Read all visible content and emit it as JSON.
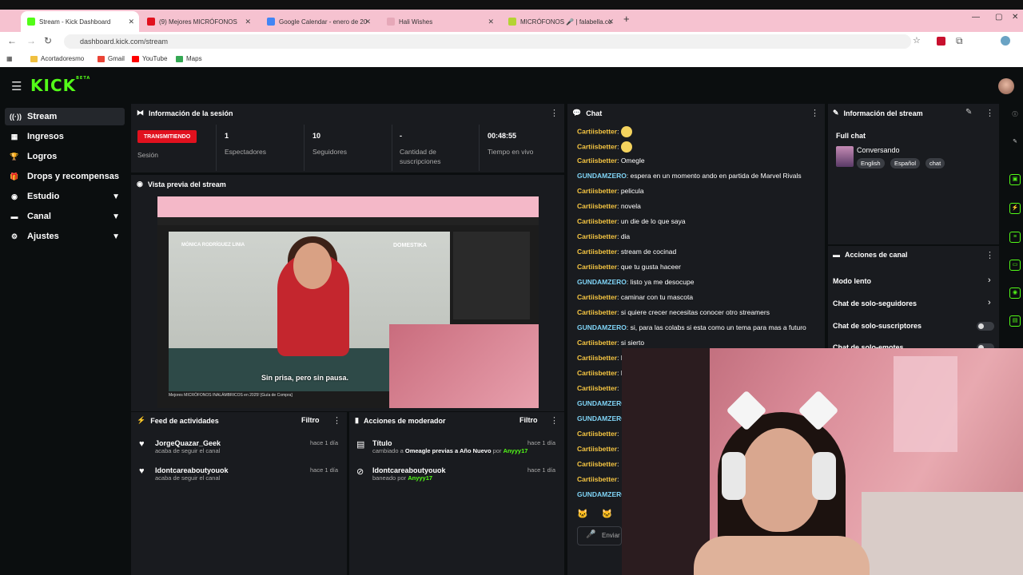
{
  "browser": {
    "tabs": [
      {
        "label": "Stream - Kick Dashboard",
        "favicon_color": "#53fc18",
        "active": true
      },
      {
        "label": "(9) Mejores MICRÓFONOS",
        "favicon_color": "#e1111e",
        "active": false
      },
      {
        "label": "Google Calendar - enero de 20",
        "favicon_color": "#4285f4",
        "active": false
      },
      {
        "label": "Hali Wishes",
        "favicon_color": "#e6a8b8",
        "active": false
      },
      {
        "label": "MICRÓFONOS 🎤 | falabella.co",
        "favicon_color": "#b5d334",
        "active": false
      }
    ],
    "new_tab": "+",
    "url": "dashboard.kick.com/stream",
    "bookmarks": [
      {
        "label": "Acortadoresmo",
        "icon_color": "#f0c040"
      },
      {
        "label": "Gmail",
        "icon_color": "#ea4335"
      },
      {
        "label": "YouTube",
        "icon_color": "#ff0000"
      },
      {
        "label": "Maps",
        "icon_color": "#34a853"
      }
    ]
  },
  "header": {
    "logo": "KICK",
    "logo_sup": "BETA"
  },
  "sidebar": {
    "items": [
      {
        "label": "Stream",
        "icon": "stream-icon",
        "glyph": "((·))",
        "active": true,
        "expandable": false
      },
      {
        "label": "Ingresos",
        "icon": "revenue-icon",
        "glyph": "▦",
        "active": false,
        "expandable": false
      },
      {
        "label": "Logros",
        "icon": "trophy-icon",
        "glyph": "🏆",
        "active": false,
        "expandable": false
      },
      {
        "label": "Drops y recompensas",
        "icon": "gift-icon",
        "glyph": "🎁",
        "active": false,
        "expandable": false
      },
      {
        "label": "Estudio",
        "icon": "studio-icon",
        "glyph": "◉",
        "active": false,
        "expandable": true
      },
      {
        "label": "Canal",
        "icon": "channel-icon",
        "glyph": "▬",
        "active": false,
        "expandable": true
      },
      {
        "label": "Ajustes",
        "icon": "gear-icon",
        "glyph": "⚙",
        "active": false,
        "expandable": true
      }
    ]
  },
  "session": {
    "title": "Información de la sesión",
    "live_badge": "TRANSMITIENDO",
    "live_label": "Sesión",
    "stats": [
      {
        "value": "1",
        "label": "Espectadores"
      },
      {
        "value": "10",
        "label": "Seguidores"
      },
      {
        "value": "-",
        "label": "Cantidad de suscripciones"
      },
      {
        "value": "00:48:55",
        "label": "Tiempo en vivo"
      }
    ]
  },
  "preview": {
    "title": "Vista previa del stream",
    "caption": "Sin prisa, pero sin pausa.",
    "video_title": "Mejores MICRÓFONOS INALÁMBRICOS en 2025! [Guía de Compra]",
    "overlay_name": "MÓNICA RODRÍGUEZ LINIA",
    "overlay_brand": "DOMESTIKA"
  },
  "activity_feed": {
    "title": "Feed de actividades",
    "filter": "Filtro",
    "items": [
      {
        "name": "JorgeQuazar_Geek",
        "sub": "acaba de seguir el canal",
        "time": "hace 1 día"
      },
      {
        "name": "Idontcareaboutyouok",
        "sub": "acaba de seguir el canal",
        "time": "hace 1 día"
      }
    ]
  },
  "moderator": {
    "title": "Acciones de moderador",
    "filter": "Filtro",
    "items": [
      {
        "name": "Título",
        "sub_pre": "cambiado a ",
        "sub_bold": "Omeagle previas a Año Nuevo",
        "sub_mid": " por ",
        "actor": "Anyyy17",
        "time": "hace 1 día"
      },
      {
        "name": "Idontcareaboutyouok",
        "sub_pre": "baneado por ",
        "sub_bold": "",
        "sub_mid": "",
        "actor": "Anyyy17",
        "time": "hace 1 día"
      }
    ]
  },
  "chat": {
    "title": "Chat",
    "messages": [
      {
        "user": "Cartiisbetter",
        "text": "",
        "emoji": true
      },
      {
        "user": "Cartiisbetter",
        "text": "",
        "emoji": true
      },
      {
        "user": "Cartiisbetter",
        "text": "Omegle"
      },
      {
        "user": "GUNDAMZERO",
        "text": "espera en un momento ando en partida de Marvel Rivals"
      },
      {
        "user": "Cartiisbetter",
        "text": "pelicula"
      },
      {
        "user": "Cartiisbetter",
        "text": "novela"
      },
      {
        "user": "Cartiisbetter",
        "text": "un die de lo que saya"
      },
      {
        "user": "Cartiisbetter",
        "text": "dia"
      },
      {
        "user": "Cartiisbetter",
        "text": "stream de cocinad"
      },
      {
        "user": "Cartiisbetter",
        "text": "que tu gusta haceer"
      },
      {
        "user": "GUNDAMZERO",
        "text": "listo ya me desocupe"
      },
      {
        "user": "Cartiisbetter",
        "text": "caminar con tu mascota"
      },
      {
        "user": "Cartiisbetter",
        "text": "si quiere crecer necesitas conocer otro streamers"
      },
      {
        "user": "GUNDAMZERO",
        "text": "si, para las colabs si esta como un tema para mas a futuro"
      },
      {
        "user": "Cartiisbetter",
        "text": "si sierto"
      },
      {
        "user": "Cartiisbetter",
        "text": "l"
      },
      {
        "user": "Cartiisbetter",
        "text": "l"
      },
      {
        "user": "Cartiisbetter",
        "text": ""
      },
      {
        "user": "GUNDAMZERO",
        "text": ""
      },
      {
        "user": "GUNDAMZERO",
        "text": ""
      },
      {
        "user": "Cartiisbetter",
        "text": ""
      },
      {
        "user": "Cartiisbetter",
        "text": ""
      },
      {
        "user": "Cartiisbetter",
        "text": ""
      },
      {
        "user": "Cartiisbetter",
        "text": ""
      },
      {
        "user": "GUNDAMZERO",
        "text": ""
      }
    ],
    "colors": {
      "Cartiisbetter": "#f5c542",
      "GUNDAMZERO": "#7fd3f5"
    },
    "send_placeholder": "Enviar"
  },
  "stream_info": {
    "title": "Información del stream",
    "stream_title": "Full chat",
    "category": "Conversando",
    "tags": [
      "English",
      "Español",
      "chat"
    ]
  },
  "channel_actions": {
    "title": "Acciones de canal",
    "items": [
      {
        "label": "Modo lento",
        "type": "chevron"
      },
      {
        "label": "Chat de solo-seguidores",
        "type": "chevron"
      },
      {
        "label": "Chat de solo-suscriptores",
        "type": "toggle"
      },
      {
        "label": "Chat de solo-emotes",
        "type": "toggle"
      }
    ]
  },
  "colors": {
    "accent": "#53fc18",
    "live": "#e1111e",
    "panel": "#191b1f",
    "background": "#0b0e0f"
  }
}
